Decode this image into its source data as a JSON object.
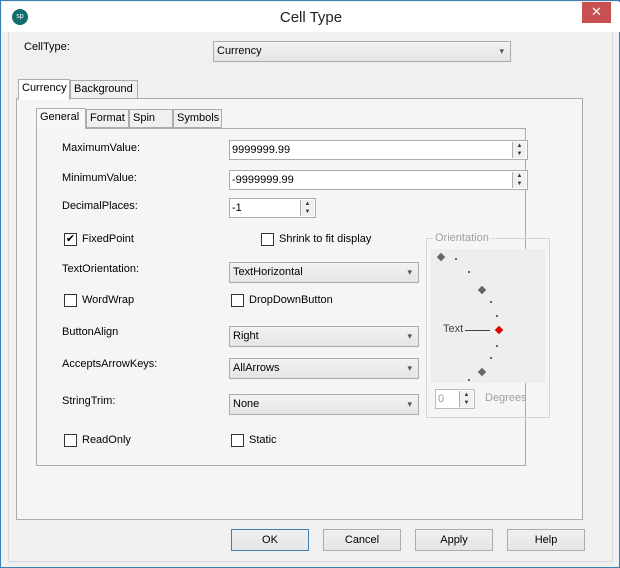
{
  "window": {
    "title": "Cell Type",
    "logo": "sp",
    "close_icon": "✕"
  },
  "celltype": {
    "label": "CellType:",
    "value": "Currency"
  },
  "outer_tabs": [
    {
      "label": "Currency",
      "active": true
    },
    {
      "label": "Background",
      "active": false
    }
  ],
  "inner_tabs": [
    {
      "label": "General",
      "active": true
    },
    {
      "label": "Format",
      "active": false
    },
    {
      "label": "Spin",
      "active": false
    },
    {
      "label": "Symbols",
      "active": false
    }
  ],
  "general": {
    "max_label": "MaximumValue:",
    "max_value": "9999999.99",
    "min_label": "MinimumValue:",
    "min_value": "-9999999.99",
    "dec_label": "DecimalPlaces:",
    "dec_value": "-1",
    "fixedpoint_label": "FixedPoint",
    "fixedpoint_checked": true,
    "shrink_label": "Shrink to fit display",
    "shrink_checked": false,
    "textorient_label": "TextOrientation:",
    "textorient_value": "TextHorizontal",
    "wordwrap_label": "WordWrap",
    "wordwrap_checked": false,
    "dropdown_label": "DropDownButton",
    "dropdown_checked": false,
    "buttonalign_label": "ButtonAlign",
    "buttonalign_value": "Right",
    "arrowkeys_label": "AcceptsArrowKeys:",
    "arrowkeys_value": "AllArrows",
    "stringtrim_label": "StringTrim:",
    "stringtrim_value": "None",
    "readonly_label": "ReadOnly",
    "readonly_checked": false,
    "static_label": "Static",
    "static_checked": false
  },
  "orientation": {
    "title": "Orientation",
    "text_label": "Text",
    "degrees_value": "0",
    "degrees_label": "Degrees",
    "selected_color": "#e00000"
  },
  "buttons": {
    "ok": "OK",
    "cancel": "Cancel",
    "apply": "Apply",
    "help": "Help"
  },
  "icons": {
    "check": "✔",
    "up": "▲",
    "down": "▼",
    "chevron": "⌄"
  }
}
